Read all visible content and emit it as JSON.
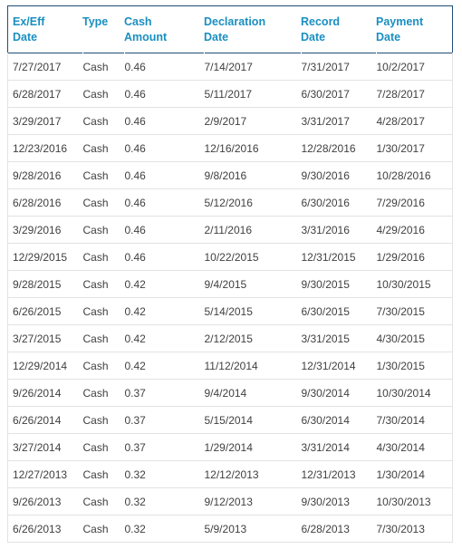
{
  "table": {
    "accent_header_text_color": "#1a8fc1",
    "header_border_color": "#1f4e79",
    "row_border_color": "#e2e2e2",
    "body_text_color": "#404040",
    "columns": [
      {
        "key": "ex_eff_date",
        "label_line1": "Ex/Eff",
        "label_line2": "Date"
      },
      {
        "key": "type",
        "label_line1": "Type",
        "label_line2": ""
      },
      {
        "key": "cash_amount",
        "label_line1": "Cash",
        "label_line2": "Amount"
      },
      {
        "key": "declaration_date",
        "label_line1": "Declaration",
        "label_line2": "Date"
      },
      {
        "key": "record_date",
        "label_line1": "Record",
        "label_line2": "Date"
      },
      {
        "key": "payment_date",
        "label_line1": "Payment",
        "label_line2": "Date"
      }
    ],
    "rows": [
      {
        "ex_eff_date": "7/27/2017",
        "type": "Cash",
        "cash_amount": "0.46",
        "declaration_date": "7/14/2017",
        "record_date": "7/31/2017",
        "payment_date": "10/2/2017"
      },
      {
        "ex_eff_date": "6/28/2017",
        "type": "Cash",
        "cash_amount": "0.46",
        "declaration_date": "5/11/2017",
        "record_date": "6/30/2017",
        "payment_date": "7/28/2017"
      },
      {
        "ex_eff_date": "3/29/2017",
        "type": "Cash",
        "cash_amount": "0.46",
        "declaration_date": "2/9/2017",
        "record_date": "3/31/2017",
        "payment_date": "4/28/2017"
      },
      {
        "ex_eff_date": "12/23/2016",
        "type": "Cash",
        "cash_amount": "0.46",
        "declaration_date": "12/16/2016",
        "record_date": "12/28/2016",
        "payment_date": "1/30/2017"
      },
      {
        "ex_eff_date": "9/28/2016",
        "type": "Cash",
        "cash_amount": "0.46",
        "declaration_date": "9/8/2016",
        "record_date": "9/30/2016",
        "payment_date": "10/28/2016"
      },
      {
        "ex_eff_date": "6/28/2016",
        "type": "Cash",
        "cash_amount": "0.46",
        "declaration_date": "5/12/2016",
        "record_date": "6/30/2016",
        "payment_date": "7/29/2016"
      },
      {
        "ex_eff_date": "3/29/2016",
        "type": "Cash",
        "cash_amount": "0.46",
        "declaration_date": "2/11/2016",
        "record_date": "3/31/2016",
        "payment_date": "4/29/2016"
      },
      {
        "ex_eff_date": "12/29/2015",
        "type": "Cash",
        "cash_amount": "0.46",
        "declaration_date": "10/22/2015",
        "record_date": "12/31/2015",
        "payment_date": "1/29/2016"
      },
      {
        "ex_eff_date": "9/28/2015",
        "type": "Cash",
        "cash_amount": "0.42",
        "declaration_date": "9/4/2015",
        "record_date": "9/30/2015",
        "payment_date": "10/30/2015"
      },
      {
        "ex_eff_date": "6/26/2015",
        "type": "Cash",
        "cash_amount": "0.42",
        "declaration_date": "5/14/2015",
        "record_date": "6/30/2015",
        "payment_date": "7/30/2015"
      },
      {
        "ex_eff_date": "3/27/2015",
        "type": "Cash",
        "cash_amount": "0.42",
        "declaration_date": "2/12/2015",
        "record_date": "3/31/2015",
        "payment_date": "4/30/2015"
      },
      {
        "ex_eff_date": "12/29/2014",
        "type": "Cash",
        "cash_amount": "0.42",
        "declaration_date": "11/12/2014",
        "record_date": "12/31/2014",
        "payment_date": "1/30/2015"
      },
      {
        "ex_eff_date": "9/26/2014",
        "type": "Cash",
        "cash_amount": "0.37",
        "declaration_date": "9/4/2014",
        "record_date": "9/30/2014",
        "payment_date": "10/30/2014"
      },
      {
        "ex_eff_date": "6/26/2014",
        "type": "Cash",
        "cash_amount": "0.37",
        "declaration_date": "5/15/2014",
        "record_date": "6/30/2014",
        "payment_date": "7/30/2014"
      },
      {
        "ex_eff_date": "3/27/2014",
        "type": "Cash",
        "cash_amount": "0.37",
        "declaration_date": "1/29/2014",
        "record_date": "3/31/2014",
        "payment_date": "4/30/2014"
      },
      {
        "ex_eff_date": "12/27/2013",
        "type": "Cash",
        "cash_amount": "0.32",
        "declaration_date": "12/12/2013",
        "record_date": "12/31/2013",
        "payment_date": "1/30/2014"
      },
      {
        "ex_eff_date": "9/26/2013",
        "type": "Cash",
        "cash_amount": "0.32",
        "declaration_date": "9/12/2013",
        "record_date": "9/30/2013",
        "payment_date": "10/30/2013"
      },
      {
        "ex_eff_date": "6/26/2013",
        "type": "Cash",
        "cash_amount": "0.32",
        "declaration_date": "5/9/2013",
        "record_date": "6/28/2013",
        "payment_date": "7/30/2013"
      }
    ]
  }
}
